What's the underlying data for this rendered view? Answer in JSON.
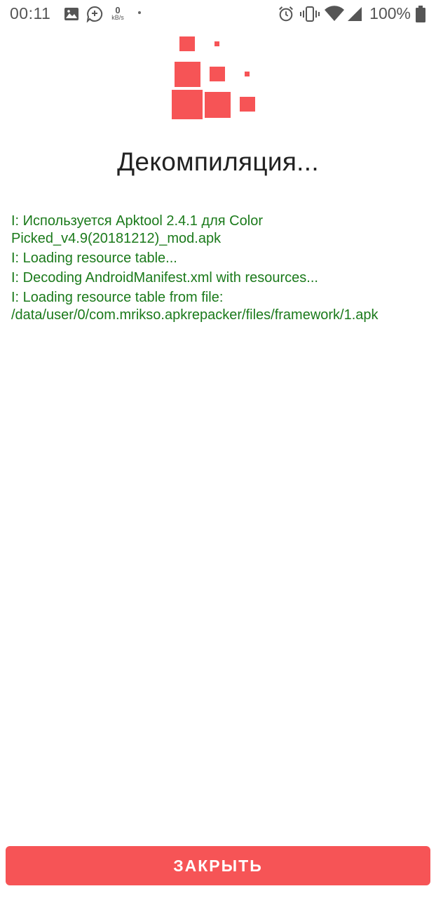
{
  "status_bar": {
    "time": "00:11",
    "net_speed_value": "0",
    "net_speed_unit": "kB/s",
    "battery_percent": "100%",
    "icons": [
      "image-icon",
      "chat-plus-icon",
      "alarm-icon",
      "vibrate-icon",
      "wifi-icon",
      "signal-icon",
      "battery-icon"
    ]
  },
  "logo": {
    "color": "#f65456"
  },
  "title": "Декомпиляция...",
  "log": {
    "color": "#1b7a1b",
    "lines": [
      "I: Используется Apktool 2.4.1 для Color Picked_v4.9(20181212)_mod.apk",
      "I: Loading resource table...",
      "I: Decoding AndroidManifest.xml with resources...",
      "I: Loading resource table from file: /data/user/0/com.mrikso.apkrepacker/files/framework/1.apk"
    ]
  },
  "close_button": {
    "label": "ЗАКРЫТЬ",
    "color": "#f65456"
  }
}
